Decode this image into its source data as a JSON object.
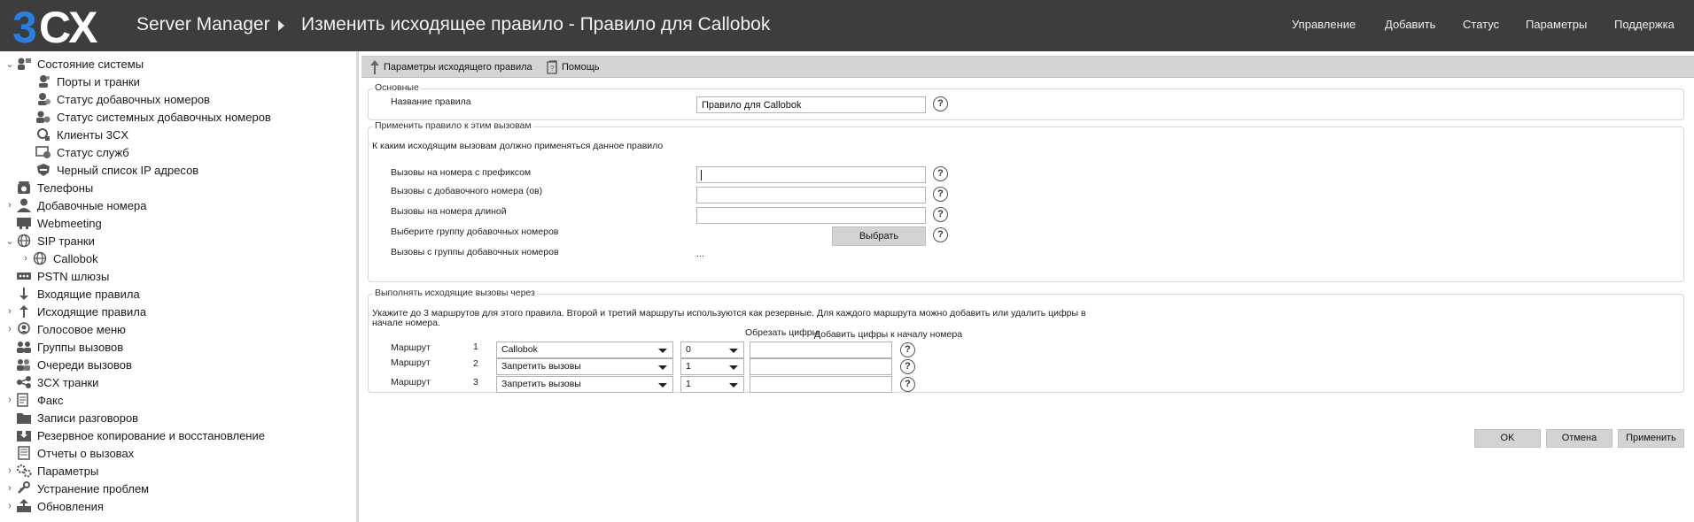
{
  "header": {
    "logo_text": "3CX",
    "app_title": "Server Manager",
    "page_title": "Изменить исходящее правило - Правило для Callobok",
    "nav": [
      "Управление",
      "Добавить",
      "Статус",
      "Параметры",
      "Поддержка"
    ]
  },
  "sidebar": {
    "items": [
      {
        "label": "Состояние системы",
        "expander": "⌄",
        "icon": "system-status-icon"
      },
      {
        "label": "Порты и транки",
        "expander": "",
        "icon": "ports-trunks-icon"
      },
      {
        "label": "Статус добавочных номеров",
        "expander": "",
        "icon": "extension-status-icon"
      },
      {
        "label": "Статус системных добавочных номеров",
        "expander": "",
        "icon": "system-extension-status-icon"
      },
      {
        "label": "Клиенты 3CX",
        "expander": "",
        "icon": "clients-icon"
      },
      {
        "label": "Статус служб",
        "expander": "",
        "icon": "services-status-icon"
      },
      {
        "label": "Черный список IP адресов",
        "expander": "",
        "icon": "blacklist-icon"
      },
      {
        "label": "Телефоны",
        "expander": "",
        "icon": "phone-icon"
      },
      {
        "label": "Добавочные номера",
        "expander": "›",
        "icon": "user-icon"
      },
      {
        "label": "Webmeeting",
        "expander": "",
        "icon": "webmeeting-icon"
      },
      {
        "label": "SIP транки",
        "expander": "⌄",
        "icon": "globe-icon"
      },
      {
        "label": "Callobok",
        "expander": "›",
        "icon": "globe-icon"
      },
      {
        "label": "PSTN шлюзы",
        "expander": "",
        "icon": "gateway-icon"
      },
      {
        "label": "Входящие правила",
        "expander": "",
        "icon": "arrow-down-icon"
      },
      {
        "label": "Исходящие правила",
        "expander": "›",
        "icon": "arrow-up-icon"
      },
      {
        "label": "Голосовое меню",
        "expander": "›",
        "icon": "ivr-icon"
      },
      {
        "label": "Группы вызовов",
        "expander": "",
        "icon": "group-icon"
      },
      {
        "label": "Очереди вызовов",
        "expander": "",
        "icon": "queue-icon"
      },
      {
        "label": "3CX транки",
        "expander": "",
        "icon": "trunk-icon"
      },
      {
        "label": "Факс",
        "expander": "›",
        "icon": "fax-icon"
      },
      {
        "label": "Записи разговоров",
        "expander": "",
        "icon": "folder-icon"
      },
      {
        "label": "Резервное копирование и восстановление",
        "expander": "",
        "icon": "backup-icon"
      },
      {
        "label": "Отчеты о вызовах",
        "expander": "",
        "icon": "report-icon"
      },
      {
        "label": "Параметры",
        "expander": "›",
        "icon": "gears-icon"
      },
      {
        "label": "Устранение проблем",
        "expander": "›",
        "icon": "troubleshoot-icon"
      },
      {
        "label": "Обновления",
        "expander": "›",
        "icon": "update-icon"
      }
    ]
  },
  "toolbar": {
    "rule_params": "Параметры исходящего правила",
    "help": "Помощь"
  },
  "basic": {
    "legend": "Основные",
    "name_label": "Название правила",
    "name_value": "Правило для Callobok"
  },
  "apply": {
    "legend": "Применить правило к этим вызовам",
    "intro": "К каким исходящим вызовам должно применяться данное правило",
    "prefix_label": "Вызовы на номера с префиксом",
    "prefix_value": "",
    "from_ext_label": "Вызовы с добавочного номера (ов)",
    "from_ext_value": "",
    "length_label": "Вызовы на номера длиной",
    "length_value": "",
    "group_label": "Выберите группу добавочных номеров",
    "select_button": "Выбрать",
    "from_group_label": "Вызовы с группы добавочных номеров",
    "from_group_value": "..."
  },
  "routes": {
    "legend": "Выполнять исходящие вызовы через",
    "intro_line1": "Укажите до 3 маршрутов для этого правила. Второй и третий маршруты используются как резервные. Для каждого маршрута можно добавить или удалить цифры в",
    "intro_line2": "начале номера.",
    "col_strip": "Обрезать цифры",
    "col_prepend": "Добавить цифры к началу номера",
    "rows": [
      {
        "label": "Маршрут",
        "num": "1",
        "route": "Callobok",
        "strip": "0",
        "prepend": ""
      },
      {
        "label": "Маршрут",
        "num": "2",
        "route": "Запретить вызовы",
        "strip": "1",
        "prepend": ""
      },
      {
        "label": "Маршрут",
        "num": "3",
        "route": "Запретить вызовы",
        "strip": "1",
        "prepend": ""
      }
    ]
  },
  "actions": {
    "ok": "OK",
    "cancel": "Отмена",
    "apply": "Применить"
  },
  "colors": {
    "header_bg": "#3d3d3d",
    "logo_blue": "#2a7de1",
    "toolbar_bg": "#d4d4d4"
  }
}
